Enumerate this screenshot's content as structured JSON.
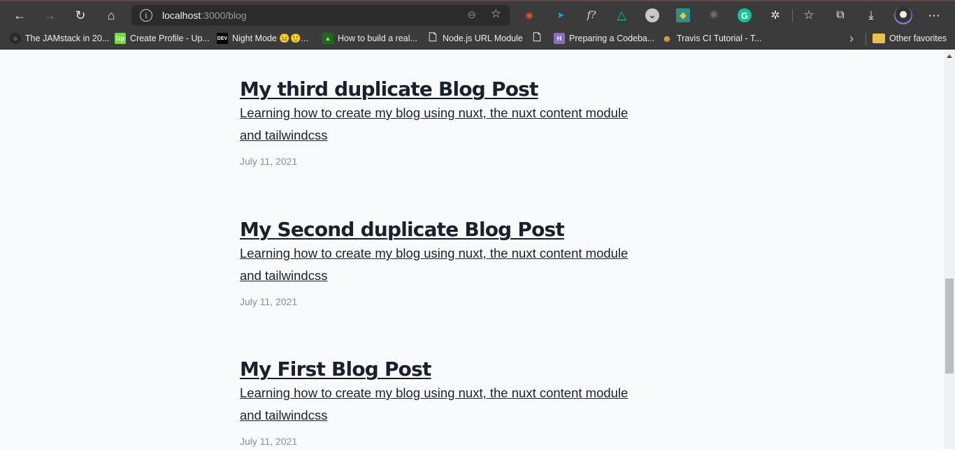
{
  "browser": {
    "url_host": "localhost",
    "url_path": ":3000/blog",
    "nav": {
      "back_icon": "←",
      "forward_icon": "→",
      "refresh_icon": "↻",
      "home_icon": "⌂"
    },
    "address_icons": {
      "info": "i",
      "zoom": "⊖",
      "add_favorite": "☆"
    },
    "toolbar_icons": {
      "favorites": "☆",
      "collections": "⧉",
      "downloads": "⤓",
      "more": "···",
      "extensions": "✲"
    },
    "extensions": [
      {
        "name": "screen-recorder",
        "glyph": "◉",
        "color": "#e74c3c"
      },
      {
        "name": "send-extension",
        "glyph": "➤",
        "color": "#1ba1e2"
      },
      {
        "name": "font-identifier",
        "glyph": "f?",
        "color": "#dddddd"
      },
      {
        "name": "nuxt-devtools",
        "glyph": "△",
        "color": "#00c58e"
      },
      {
        "name": "pocket-like",
        "glyph": "⌄",
        "color": "#d0d0d0"
      },
      {
        "name": "toucan",
        "glyph": "◆",
        "color": "#4db6ac"
      },
      {
        "name": "react-devtools",
        "glyph": "⚛",
        "color": "#b0b0b0"
      },
      {
        "name": "grammarly",
        "glyph": "G",
        "color": "#15c39a"
      }
    ],
    "bookmarks": [
      {
        "label": "The JAMstack in 20...",
        "icon": "◆",
        "icon_bg": "#2a2a2a",
        "icon_fg": "#555555"
      },
      {
        "label": "Create Profile - Up...",
        "icon": "Up",
        "icon_bg": "#6fda44",
        "icon_fg": "#ffffff"
      },
      {
        "label": "Night Mode 😐🙂...",
        "icon": "DEV",
        "icon_bg": "#000000",
        "icon_fg": "#ffffff"
      },
      {
        "label": "How to build a real...",
        "icon": "▲",
        "icon_bg": "#1e6b1e",
        "icon_fg": "#9be29b"
      },
      {
        "label": "Node.js URL Module",
        "icon": "🗋",
        "icon_bg": "transparent",
        "icon_fg": "#e6e6e6"
      },
      {
        "label": "",
        "icon": "🗋",
        "icon_bg": "transparent",
        "icon_fg": "#e6e6e6"
      },
      {
        "label": "Preparing a Codeba...",
        "icon": "H",
        "icon_bg": "#8e6bbf",
        "icon_fg": "#ffffff"
      },
      {
        "label": "Travis CI Tutorial - T...",
        "icon": "☻",
        "icon_bg": "transparent",
        "icon_fg": "#d9a441"
      }
    ],
    "bookmarks_overflow_icon": "›",
    "other_favorites": "Other favorites",
    "other_favorites_icon": "📁"
  },
  "posts": [
    {
      "title": "My third duplicate Blog Post",
      "description": "Learning how to create my blog using nuxt, the nuxt content module and tailwindcss",
      "date": "July 11, 2021"
    },
    {
      "title": "My Second duplicate Blog Post",
      "description": "Learning how to create my blog using nuxt, the nuxt content module and tailwindcss",
      "date": "July 11, 2021"
    },
    {
      "title": "My First Blog Post",
      "description": "Learning how to create my blog using nuxt, the nuxt content module and tailwindcss",
      "date": "July 11, 2021"
    }
  ]
}
